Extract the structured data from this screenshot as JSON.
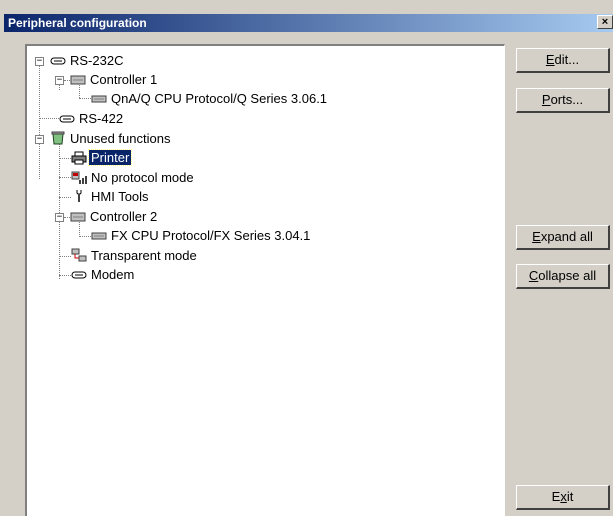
{
  "window": {
    "title": "Peripheral configuration",
    "close_glyph": "×"
  },
  "tree": {
    "rs232c": {
      "label": "RS-232C",
      "icon": "serial-port-icon",
      "expander": "−"
    },
    "controller1": {
      "label": "Controller 1",
      "icon": "controller-icon",
      "expander": "−"
    },
    "qna_protocol": {
      "label": "QnA/Q CPU Protocol/Q Series 3.06.1",
      "icon": "protocol-icon"
    },
    "rs422": {
      "label": "RS-422",
      "icon": "serial-port-icon"
    },
    "unused": {
      "label": "Unused functions",
      "icon": "recycle-bin-icon",
      "expander": "−"
    },
    "printer": {
      "label": "Printer",
      "icon": "printer-icon",
      "selected": true
    },
    "no_protocol": {
      "label": "No protocol mode",
      "icon": "no-protocol-icon"
    },
    "hmi_tools": {
      "label": "HMI Tools",
      "icon": "wrench-icon"
    },
    "controller2": {
      "label": "Controller 2",
      "icon": "controller-icon",
      "expander": "−"
    },
    "fx_protocol": {
      "label": "FX CPU Protocol/FX Series 3.04.1",
      "icon": "protocol-icon"
    },
    "transparent": {
      "label": "Transparent mode",
      "icon": "transparent-mode-icon"
    },
    "modem": {
      "label": "Modem",
      "icon": "modem-icon"
    }
  },
  "buttons": {
    "edit": {
      "pre": "",
      "ul": "E",
      "post": "dit..."
    },
    "ports": {
      "pre": "",
      "ul": "P",
      "post": "orts..."
    },
    "expand_all": {
      "pre": "",
      "ul": "E",
      "post": "xpand all"
    },
    "collapse_all": {
      "pre": "",
      "ul": "C",
      "post": "ollapse all"
    },
    "exit": {
      "pre": "E",
      "ul": "x",
      "post": "it"
    }
  }
}
